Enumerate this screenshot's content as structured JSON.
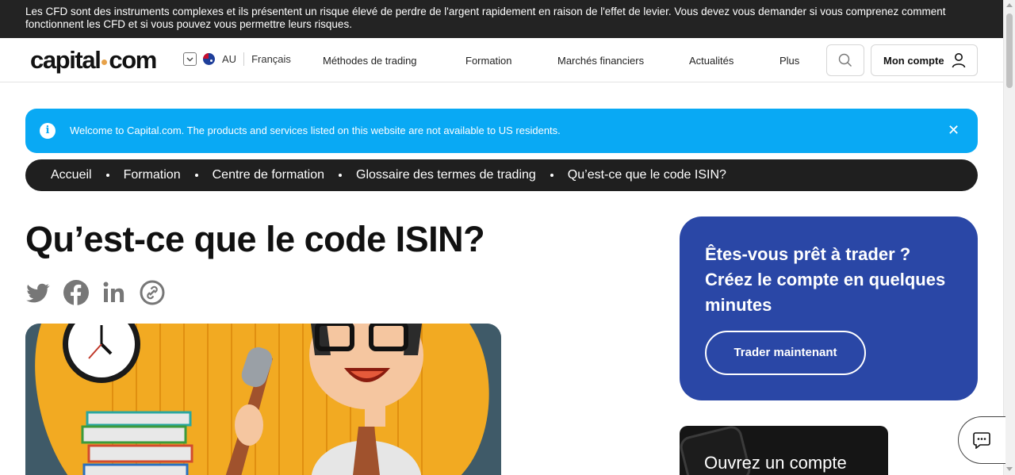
{
  "risk_banner": {
    "text": "Les CFD sont des instruments complexes et ils présentent un risque élevé de perdre de l'argent rapidement en raison de l'effet de levier. Vous devez vous demander si vous comprenez comment fonctionnent les CFD et si vous pouvez vous permettre leurs risques."
  },
  "header": {
    "logo_left": "capital",
    "logo_right": "com",
    "region_code": "AU",
    "language": "Français",
    "nav": [
      "Méthodes de trading",
      "Formation",
      "Marchés financiers",
      "Actualités",
      "Plus"
    ],
    "account_label": "Mon compte"
  },
  "notice": {
    "message": "Welcome to Capital.com. The products and services listed on this website are not available to US residents.",
    "close_glyph": "✕",
    "info_glyph": "i"
  },
  "breadcrumb": [
    "Accueil",
    "Formation",
    "Centre de formation",
    "Glossaire des termes de trading",
    "Qu’est-ce que le code ISIN?"
  ],
  "article": {
    "title": "Qu’est-ce que le code ISIN?",
    "share_icons": [
      "twitter-icon",
      "facebook-icon",
      "linkedin-icon",
      "copy-link-icon"
    ]
  },
  "cta": {
    "text": "Êtes-vous prêt à trader ? Créez le compte en quelques minutes",
    "button": "Trader maintenant"
  },
  "promo": {
    "text": "Ouvrez un compte"
  },
  "colors": {
    "risk_bar": "#232323",
    "notice": "#09a9f4",
    "breadcrumb": "#1f1f1f",
    "cta_card": "#2a47a6",
    "logo_dot": "#e7a24a"
  }
}
